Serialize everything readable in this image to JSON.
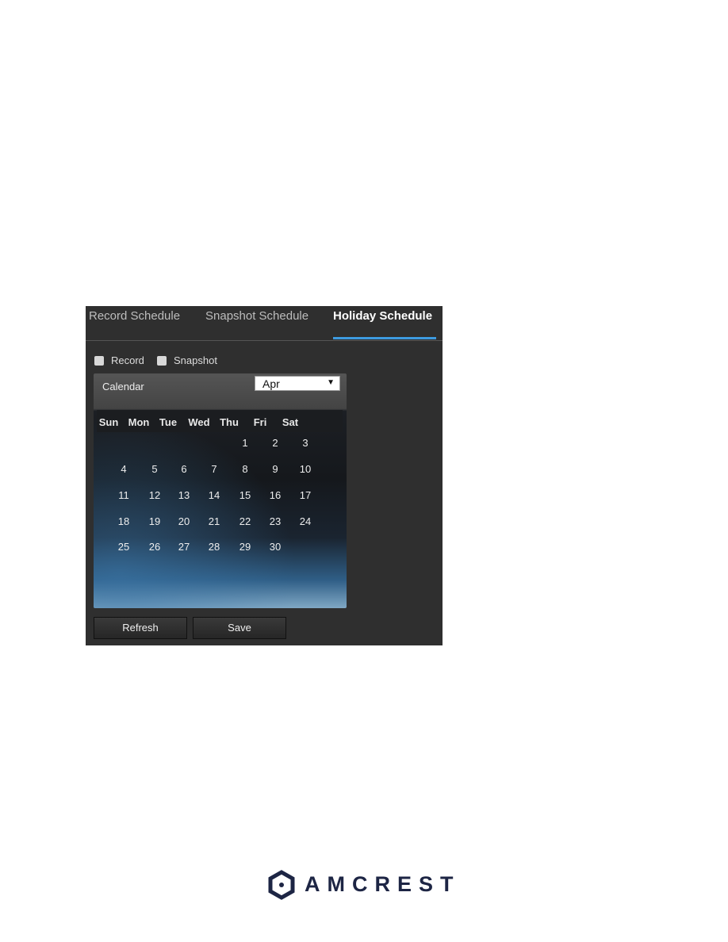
{
  "tabs": [
    {
      "label": "Record Schedule",
      "active": false
    },
    {
      "label": "Snapshot Schedule",
      "active": false
    },
    {
      "label": "Holiday Schedule",
      "active": true
    }
  ],
  "accent": "#3d9be0",
  "checkboxes": [
    {
      "label": "Record",
      "checked": false
    },
    {
      "label": "Snapshot",
      "checked": false
    }
  ],
  "calendar": {
    "title": "Calendar",
    "month": "Apr",
    "weekdays": [
      "Sun",
      "Mon",
      "Tue",
      "Wed",
      "Thu",
      "Fri",
      "Sat"
    ],
    "first_weekday_index": 4,
    "days": [
      1,
      2,
      3,
      4,
      5,
      6,
      7,
      8,
      9,
      10,
      11,
      12,
      13,
      14,
      15,
      16,
      17,
      18,
      19,
      20,
      21,
      22,
      23,
      24,
      25,
      26,
      27,
      28,
      29,
      30
    ]
  },
  "buttons": {
    "refresh": "Refresh",
    "save": "Save"
  },
  "logo": {
    "text": "AMCREST",
    "color": "#1d2544"
  }
}
